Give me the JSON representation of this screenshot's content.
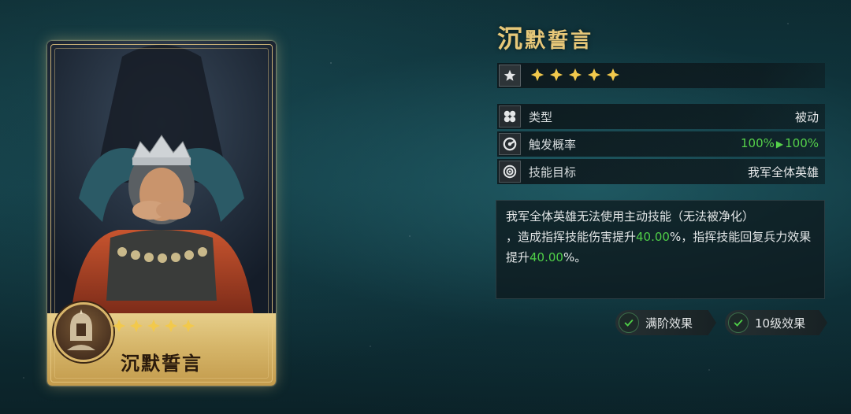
{
  "card": {
    "name": "沉默誓言",
    "stars": 5
  },
  "skill": {
    "title_first": "沉",
    "title_rest": "默誓言",
    "stars": 5
  },
  "info_rows": {
    "type_label": "类型",
    "type_value": "被动",
    "trigger_label": "触发概率",
    "trigger_from": "100%",
    "trigger_to": "100%",
    "target_label": "技能目标",
    "target_value": "我军全体英雄"
  },
  "description": {
    "part1": "我军全体英雄无法使用主动技能（无法被净化）",
    "part2": "，造成指挥技能伤害提升",
    "value1": "40.00",
    "part3": "%，指挥技能回复兵力效果提升",
    "value2": "40.00",
    "part4": "%。"
  },
  "buttons": {
    "full_rank": "满阶效果",
    "level10": "10级效果"
  },
  "colors": {
    "title_gold": "#e7c879",
    "star_gold": "#f2c94c",
    "highlight_green": "#4fcf48"
  },
  "icons": {
    "star_row": "star-icon",
    "type": "clover-icon",
    "trigger": "gauge-icon",
    "target": "target-icon",
    "check": "check-icon"
  }
}
